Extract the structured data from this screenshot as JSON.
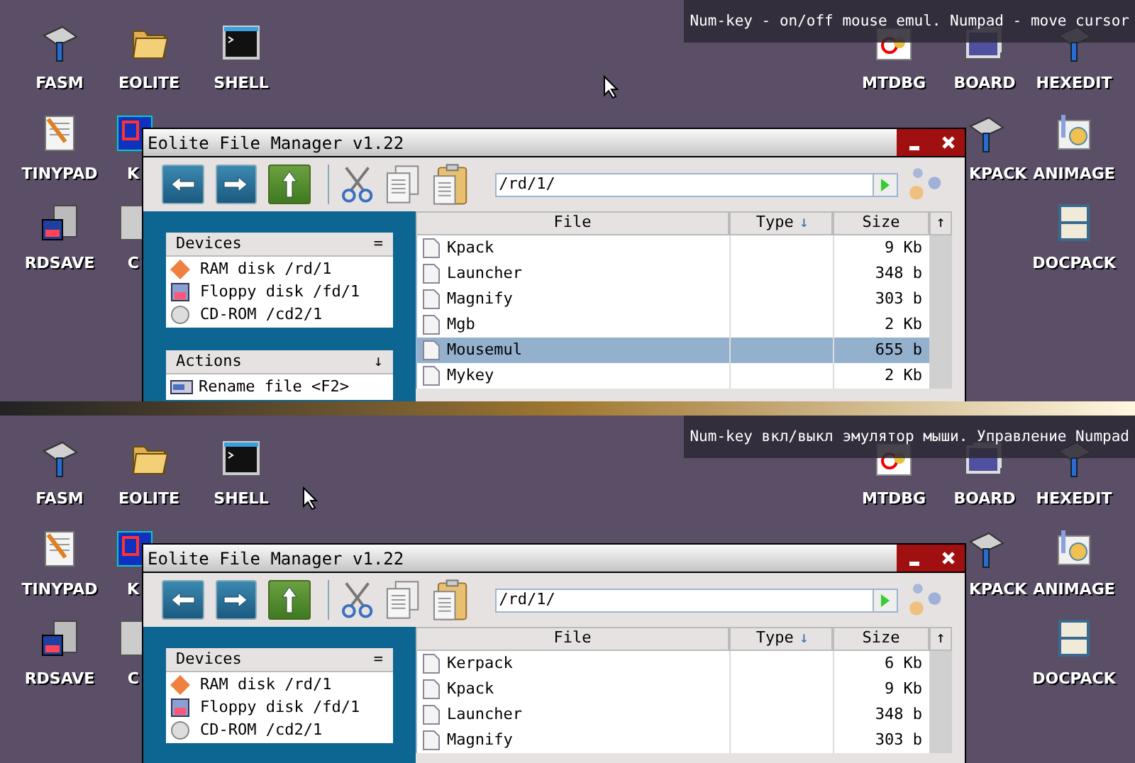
{
  "screens": [
    {
      "tooltip": "Num-key - on/off mouse emul. Numpad - move cursor",
      "desktop_icons": [
        {
          "label": "FASM"
        },
        {
          "label": "EOLITE"
        },
        {
          "label": "SHELL"
        },
        {
          "label": "TINYPAD"
        },
        {
          "label": "K"
        },
        {
          "label": "RDSAVE"
        },
        {
          "label": "C"
        },
        {
          "label": "MTDBG"
        },
        {
          "label": "BOARD"
        },
        {
          "label": "HEXEDIT"
        },
        {
          "label": "KPACK"
        },
        {
          "label": "ANIMAGE"
        },
        {
          "label": "DOCPACK"
        }
      ],
      "window": {
        "title": "Eolite File Manager v1.22",
        "path": "/rd/1/",
        "devices": {
          "title": "Devices",
          "toggle": "=",
          "items": [
            {
              "label": "RAM disk /rd/1"
            },
            {
              "label": "Floppy disk /fd/1"
            },
            {
              "label": "CD-ROM /cd2/1"
            }
          ]
        },
        "actions": {
          "title": "Actions",
          "toggle": "↓",
          "items": [
            {
              "label": "Rename file <F2>"
            }
          ]
        },
        "columns": {
          "file": "File",
          "type": "Type",
          "type_sort": "↓",
          "size": "Size",
          "scroll_up": "↑"
        },
        "rows": [
          {
            "name": "Kpack",
            "size": "9 Kb",
            "selected": false
          },
          {
            "name": "Launcher",
            "size": "348 b",
            "selected": false
          },
          {
            "name": "Magnify",
            "size": "303 b",
            "selected": false
          },
          {
            "name": "Mgb",
            "size": "2 Kb",
            "selected": false
          },
          {
            "name": "Mousemul",
            "size": "655 b",
            "selected": true
          },
          {
            "name": "Mykey",
            "size": "2 Kb",
            "selected": false
          }
        ]
      }
    },
    {
      "tooltip": "Num-key вкл/выкл эмулятор мыши. Управление Numpad",
      "desktop_icons": [
        {
          "label": "FASM"
        },
        {
          "label": "EOLITE"
        },
        {
          "label": "SHELL"
        },
        {
          "label": "TINYPAD"
        },
        {
          "label": "K"
        },
        {
          "label": "RDSAVE"
        },
        {
          "label": "C"
        },
        {
          "label": "MTDBG"
        },
        {
          "label": "BOARD"
        },
        {
          "label": "HEXEDIT"
        },
        {
          "label": "KPACK"
        },
        {
          "label": "ANIMAGE"
        },
        {
          "label": "DOCPACK"
        }
      ],
      "window": {
        "title": "Eolite File Manager v1.22",
        "path": "/rd/1/",
        "devices": {
          "title": "Devices",
          "toggle": "=",
          "items": [
            {
              "label": "RAM disk /rd/1"
            },
            {
              "label": "Floppy disk /fd/1"
            },
            {
              "label": "CD-ROM /cd2/1"
            }
          ]
        },
        "columns": {
          "file": "File",
          "type": "Type",
          "type_sort": "↓",
          "size": "Size",
          "scroll_up": "↑"
        },
        "rows": [
          {
            "name": "Kerpack",
            "size": "6 Kb",
            "selected": false
          },
          {
            "name": "Kpack",
            "size": "9 Kb",
            "selected": false
          },
          {
            "name": "Launcher",
            "size": "348 b",
            "selected": false
          },
          {
            "name": "Magnify",
            "size": "303 b",
            "selected": false
          }
        ]
      }
    }
  ]
}
